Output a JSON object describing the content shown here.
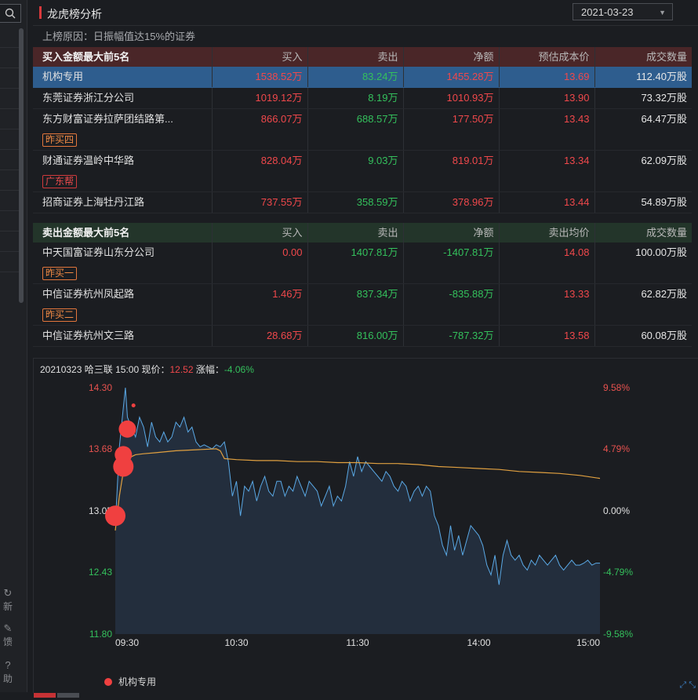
{
  "header": {
    "title": "龙虎榜分析",
    "date": "2021-03-23"
  },
  "reason": "上榜原因：日振幅值达15%的证券",
  "buy_table": {
    "headers": [
      "买入金额最大前5名",
      "买入",
      "卖出",
      "净额",
      "预估成本价",
      "成交数量"
    ],
    "rows": [
      {
        "name": "机构专用",
        "buy": "1538.52万",
        "sell": "83.24万",
        "net": "1455.28万",
        "price": "13.69",
        "volume": "112.40万股",
        "tag": ""
      },
      {
        "name": "东莞证券浙江分公司",
        "buy": "1019.12万",
        "sell": "8.19万",
        "net": "1010.93万",
        "price": "13.90",
        "volume": "73.32万股",
        "tag": ""
      },
      {
        "name": "东方财富证券拉萨团结路第...",
        "buy": "866.07万",
        "sell": "688.57万",
        "net": "177.50万",
        "price": "13.43",
        "volume": "64.47万股",
        "tag": "昨买四"
      },
      {
        "name": "财通证券温岭中华路",
        "buy": "828.04万",
        "sell": "9.03万",
        "net": "819.01万",
        "price": "13.34",
        "volume": "62.09万股",
        "tag": "广东帮"
      },
      {
        "name": "招商证券上海牡丹江路",
        "buy": "737.55万",
        "sell": "358.59万",
        "net": "378.96万",
        "price": "13.44",
        "volume": "54.89万股",
        "tag": ""
      }
    ]
  },
  "sell_table": {
    "headers": [
      "卖出金额最大前5名",
      "买入",
      "卖出",
      "净额",
      "卖出均价",
      "成交数量"
    ],
    "rows": [
      {
        "name": "中天国富证券山东分公司",
        "buy": "0.00",
        "sell": "1407.81万",
        "net": "-1407.81万",
        "price": "14.08",
        "volume": "100.00万股",
        "tag": "昨买一"
      },
      {
        "name": "中信证券杭州凤起路",
        "buy": "1.46万",
        "sell": "837.34万",
        "net": "-835.88万",
        "price": "13.33",
        "volume": "62.82万股",
        "tag": "昨买二"
      },
      {
        "name": "中信证券杭州文三路",
        "buy": "28.68万",
        "sell": "816.00万",
        "net": "-787.32万",
        "price": "13.58",
        "volume": "60.08万股",
        "tag": ""
      }
    ]
  },
  "chart_info": {
    "date": "20210323",
    "stock": "哈三联",
    "time": "15:00",
    "price_label": "现价：",
    "price": "12.52",
    "change_label": "涨幅：",
    "change": "-4.06%"
  },
  "side_tools": [
    "新",
    "馈",
    "助"
  ],
  "legend": "机构专用",
  "colors": {
    "up": "#f0484b",
    "down": "#34c05c",
    "price_line": "#5aa9e6",
    "avg_line": "#e0a040",
    "marker": "#f04040"
  },
  "chart_data": {
    "type": "line",
    "y_ticks_left": [
      "14.30",
      "13.68",
      "13.05",
      "12.43",
      "11.80"
    ],
    "y_ticks_right": [
      "9.58%",
      "4.79%",
      "0.00%",
      "-4.79%",
      "-9.58%"
    ],
    "x_ticks": [
      "09:30",
      "10:30",
      "11:30",
      "14:00",
      "15:00"
    ],
    "ylim": [
      11.8,
      14.3
    ],
    "base_price": 13.05,
    "series": [
      {
        "name": "price",
        "t": [
          0,
          2,
          4,
          5,
          6,
          8,
          10,
          12,
          14,
          16,
          18,
          20,
          22,
          24,
          26,
          28,
          30,
          32,
          34,
          36,
          38,
          40,
          42,
          44,
          46,
          48,
          50,
          52,
          54,
          56,
          58,
          60,
          62,
          64,
          66,
          68,
          70,
          72,
          74,
          76,
          78,
          80,
          82,
          84,
          86,
          88,
          90,
          92,
          94,
          96,
          98,
          100,
          102,
          104,
          106,
          108,
          110,
          112,
          114,
          116,
          118,
          120,
          122,
          124,
          126,
          128,
          130,
          132,
          134,
          136,
          138,
          140,
          142,
          144,
          146,
          148,
          150,
          152,
          154,
          156,
          158,
          160,
          162,
          164,
          166,
          168,
          170,
          172,
          174,
          176,
          178,
          180,
          182,
          184,
          186,
          188,
          190,
          192,
          194,
          196,
          198,
          200,
          202,
          204,
          206,
          208,
          210,
          212,
          214,
          216,
          218,
          220,
          222,
          224,
          226,
          228,
          230,
          232,
          234,
          236,
          238,
          240
        ],
        "values": [
          12.9,
          13.7,
          14.1,
          14.3,
          14.0,
          13.9,
          13.8,
          14.0,
          13.9,
          13.7,
          13.95,
          13.8,
          13.75,
          13.85,
          13.75,
          13.8,
          13.95,
          13.9,
          14.0,
          13.85,
          13.9,
          13.75,
          13.7,
          13.72,
          13.7,
          13.68,
          13.72,
          13.7,
          13.75,
          13.55,
          13.2,
          13.35,
          13.0,
          13.3,
          13.25,
          13.35,
          13.15,
          13.3,
          13.4,
          13.25,
          13.2,
          13.35,
          13.35,
          13.2,
          13.3,
          13.25,
          13.4,
          13.3,
          13.2,
          13.35,
          13.3,
          13.25,
          13.1,
          13.2,
          13.3,
          13.1,
          13.2,
          13.15,
          13.3,
          13.55,
          13.4,
          13.6,
          13.45,
          13.55,
          13.5,
          13.45,
          13.4,
          13.35,
          13.45,
          13.4,
          13.3,
          13.25,
          13.35,
          13.3,
          13.15,
          13.25,
          13.3,
          13.2,
          13.3,
          13.25,
          13.0,
          12.9,
          12.7,
          12.6,
          12.9,
          12.65,
          12.8,
          12.6,
          12.75,
          12.9,
          12.85,
          12.8,
          12.7,
          12.5,
          12.4,
          12.6,
          12.3,
          12.6,
          12.75,
          12.6,
          12.55,
          12.6,
          12.5,
          12.45,
          12.55,
          12.5,
          12.6,
          12.55,
          12.5,
          12.55,
          12.6,
          12.5,
          12.45,
          12.5,
          12.55,
          12.5,
          12.5,
          12.52,
          12.55,
          12.5,
          12.52,
          12.52
        ]
      },
      {
        "name": "average",
        "t": [
          0,
          2,
          4,
          6,
          8,
          10,
          14,
          20,
          30,
          40,
          50,
          52,
          54,
          60,
          70,
          80,
          90,
          100,
          110,
          120,
          130,
          140,
          150,
          160,
          170,
          180,
          190,
          200,
          210,
          220,
          230,
          240
        ],
        "values": [
          12.85,
          13.2,
          13.45,
          13.55,
          13.6,
          13.62,
          13.63,
          13.64,
          13.66,
          13.67,
          13.68,
          13.66,
          13.58,
          13.57,
          13.56,
          13.56,
          13.55,
          13.55,
          13.54,
          13.54,
          13.53,
          13.53,
          13.52,
          13.5,
          13.49,
          13.48,
          13.47,
          13.45,
          13.44,
          13.43,
          13.41,
          13.38
        ]
      }
    ],
    "markers": [
      {
        "t": 0,
        "value": 13.0,
        "size": "large"
      },
      {
        "t": 4,
        "value": 13.5,
        "size": "large"
      },
      {
        "t": 4,
        "value": 13.62,
        "size": "medium"
      },
      {
        "t": 6,
        "value": 13.88,
        "size": "medium"
      },
      {
        "t": 9,
        "value": 14.12,
        "size": "small"
      }
    ]
  }
}
